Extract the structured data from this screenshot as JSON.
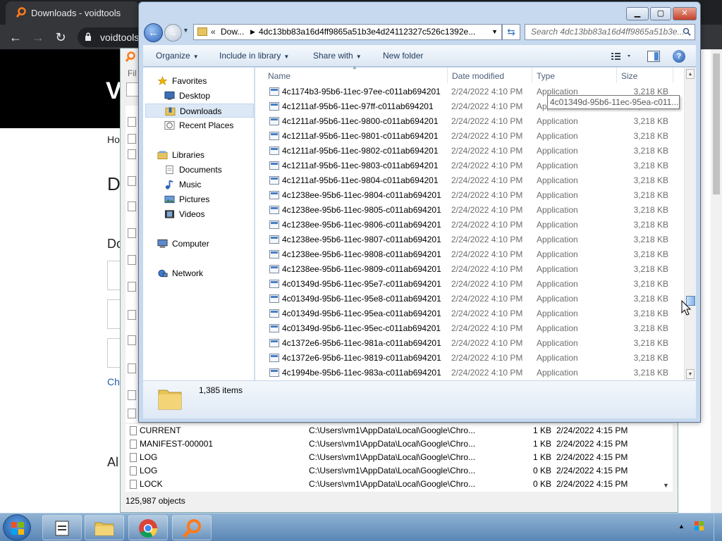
{
  "chrome": {
    "tab_title": "Downloads - voidtools",
    "omnibox_text": "voidtools",
    "page_heading_fragment": "V",
    "side_text": {
      "home": "Ho",
      "d1": "D",
      "d2": "Do",
      "ch": "Ch",
      "al": "Al"
    }
  },
  "everything": {
    "menu_fragment": "Fil",
    "col_fragment": "Na",
    "rows": [
      {
        "name": "CURRENT",
        "path": "C:\\Users\\vm1\\AppData\\Local\\Google\\Chro...",
        "size": "1 KB",
        "date": "2/24/2022 4:15 PM"
      },
      {
        "name": "MANIFEST-000001",
        "path": "C:\\Users\\vm1\\AppData\\Local\\Google\\Chro...",
        "size": "1 KB",
        "date": "2/24/2022 4:15 PM"
      },
      {
        "name": "LOG",
        "path": "C:\\Users\\vm1\\AppData\\Local\\Google\\Chro...",
        "size": "1 KB",
        "date": "2/24/2022 4:15 PM"
      },
      {
        "name": "LOG",
        "path": "C:\\Users\\vm1\\AppData\\Local\\Google\\Chro...",
        "size": "0 KB",
        "date": "2/24/2022 4:15 PM"
      },
      {
        "name": "LOCK",
        "path": "C:\\Users\\vm1\\AppData\\Local\\Google\\Chro...",
        "size": "0 KB",
        "date": "2/24/2022 4:15 PM"
      }
    ],
    "status": "125,987 objects"
  },
  "explorer": {
    "address_prefix": "«",
    "address_part1": "Dow...",
    "address_part2": "4dc13bb83a16d4ff9865a51b3e4d24112327c526c1392e...",
    "search_placeholder": "Search 4dc13bb83a16d4ff9865a51b3e...",
    "toolbar": {
      "organize": "Organize",
      "include": "Include in library",
      "share": "Share with",
      "new_folder": "New folder"
    },
    "nav": {
      "favorites": "Favorites",
      "desktop": "Desktop",
      "downloads": "Downloads",
      "recent": "Recent Places",
      "libraries": "Libraries",
      "documents": "Documents",
      "music": "Music",
      "pictures": "Pictures",
      "videos": "Videos",
      "computer": "Computer",
      "network": "Network"
    },
    "columns": {
      "name": "Name",
      "date": "Date modified",
      "type": "Type",
      "size": "Size"
    },
    "files": [
      {
        "name": "4c1174b3-95b6-11ec-97ee-c011ab694201",
        "date": "2/24/2022 4:10 PM",
        "type": "Application",
        "size": "3,218 KB"
      },
      {
        "name": "4c1211af-95b6-11ec-97ff-c011ab694201",
        "date": "2/24/2022 4:10 PM",
        "type": "Application",
        "size": "3,218 KB"
      },
      {
        "name": "4c1211af-95b6-11ec-9800-c011ab694201",
        "date": "2/24/2022 4:10 PM",
        "type": "Application",
        "size": "3,218 KB"
      },
      {
        "name": "4c1211af-95b6-11ec-9801-c011ab694201",
        "date": "2/24/2022 4:10 PM",
        "type": "Application",
        "size": "3,218 KB"
      },
      {
        "name": "4c1211af-95b6-11ec-9802-c011ab694201",
        "date": "2/24/2022 4:10 PM",
        "type": "Application",
        "size": "3,218 KB"
      },
      {
        "name": "4c1211af-95b6-11ec-9803-c011ab694201",
        "date": "2/24/2022 4:10 PM",
        "type": "Application",
        "size": "3,218 KB"
      },
      {
        "name": "4c1211af-95b6-11ec-9804-c011ab694201",
        "date": "2/24/2022 4:10 PM",
        "type": "Application",
        "size": "3,218 KB"
      },
      {
        "name": "4c1238ee-95b6-11ec-9804-c011ab694201",
        "date": "2/24/2022 4:10 PM",
        "type": "Application",
        "size": "3,218 KB"
      },
      {
        "name": "4c1238ee-95b6-11ec-9805-c011ab694201",
        "date": "2/24/2022 4:10 PM",
        "type": "Application",
        "size": "3,218 KB"
      },
      {
        "name": "4c1238ee-95b6-11ec-9806-c011ab694201",
        "date": "2/24/2022 4:10 PM",
        "type": "Application",
        "size": "3,218 KB"
      },
      {
        "name": "4c1238ee-95b6-11ec-9807-c011ab694201",
        "date": "2/24/2022 4:10 PM",
        "type": "Application",
        "size": "3,218 KB"
      },
      {
        "name": "4c1238ee-95b6-11ec-9808-c011ab694201",
        "date": "2/24/2022 4:10 PM",
        "type": "Application",
        "size": "3,218 KB"
      },
      {
        "name": "4c1238ee-95b6-11ec-9809-c011ab694201",
        "date": "2/24/2022 4:10 PM",
        "type": "Application",
        "size": "3,218 KB"
      },
      {
        "name": "4c01349d-95b6-11ec-95e7-c011ab694201",
        "date": "2/24/2022 4:10 PM",
        "type": "Application",
        "size": "3,218 KB"
      },
      {
        "name": "4c01349d-95b6-11ec-95e8-c011ab694201",
        "date": "2/24/2022 4:10 PM",
        "type": "Application",
        "size": "3,218 KB"
      },
      {
        "name": "4c01349d-95b6-11ec-95ea-c011ab694201",
        "date": "2/24/2022 4:10 PM",
        "type": "Application",
        "size": "3,218 KB"
      },
      {
        "name": "4c01349d-95b6-11ec-95ec-c011ab694201",
        "date": "2/24/2022 4:10 PM",
        "type": "Application",
        "size": "3,218 KB"
      },
      {
        "name": "4c1372e6-95b6-11ec-981a-c011ab694201",
        "date": "2/24/2022 4:10 PM",
        "type": "Application",
        "size": "3,218 KB"
      },
      {
        "name": "4c1372e6-95b6-11ec-9819-c011ab694201",
        "date": "2/24/2022 4:10 PM",
        "type": "Application",
        "size": "3,218 KB"
      },
      {
        "name": "4c1994be-95b6-11ec-983a-c011ab694201",
        "date": "2/24/2022 4:10 PM",
        "type": "Application",
        "size": "3,218 KB"
      }
    ],
    "tooltip": "4c01349d-95b6-11ec-95ea-c011...",
    "item_count": "1,385 items"
  },
  "icons": {
    "back": "back-arrow-icon",
    "forward": "forward-arrow-icon",
    "refresh": "refresh-icon",
    "search": "search-icon",
    "help": "help-icon",
    "folder": "folder-icon",
    "application": "application-icon"
  },
  "colors": {
    "explorer_frame": "#c7d9ee",
    "close_button": "#c4412a",
    "selected_nav": "#dce8f6",
    "chrome_dark": "#202124"
  }
}
